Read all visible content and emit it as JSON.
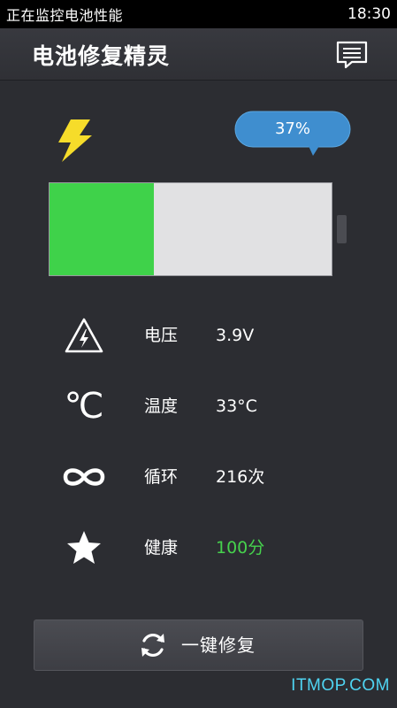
{
  "status_bar": {
    "text": "正在监控电池性能",
    "time": "18:30"
  },
  "app_bar": {
    "title": "电池修复精灵",
    "menu_icon": "message-icon"
  },
  "battery": {
    "percent_label": "37%",
    "level": 0.37,
    "fill_color": "#3fd24a",
    "bubble_color": "#3f8ecf",
    "icon": "lightning-bolt-icon"
  },
  "stats": [
    {
      "icon": "voltage-warning-icon",
      "label": "电压",
      "value": "3.9V"
    },
    {
      "icon": "celsius-icon",
      "icon_text": "℃",
      "label": "温度",
      "value": "33°C"
    },
    {
      "icon": "infinity-icon",
      "label": "循环",
      "value": "216次"
    },
    {
      "icon": "star-icon",
      "label": "健康",
      "value": "100分",
      "value_color": "#46d24d"
    }
  ],
  "repair_button": {
    "label": "一键修复",
    "icon": "refresh-icon"
  },
  "watermark": "ITMOP.COM"
}
